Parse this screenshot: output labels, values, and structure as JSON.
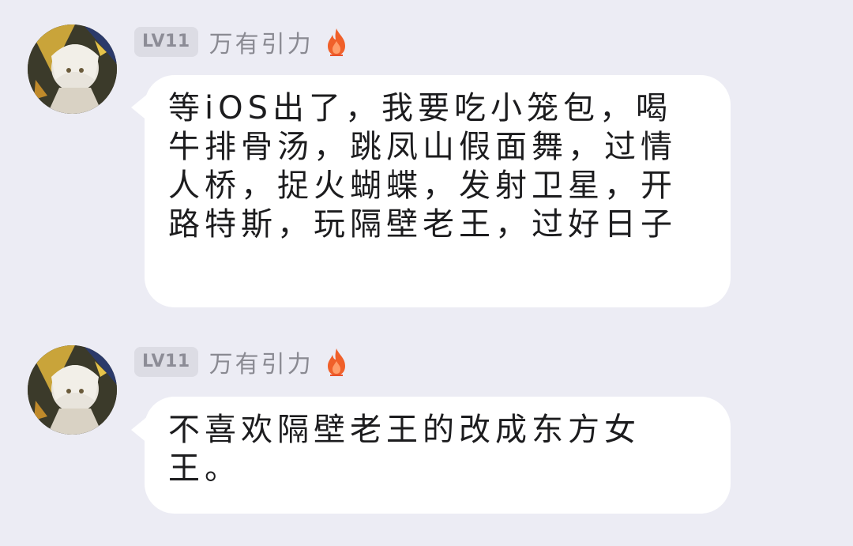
{
  "colors": {
    "background": "#ececf4",
    "bubble": "#ffffff",
    "badge_bg": "#dcdce4",
    "badge_text": "#8c8c96",
    "username": "#8a8a92",
    "flame": "#f0602a"
  },
  "messages": [
    {
      "avatar_icon": "anime-character-avatar",
      "level": "LV11",
      "username": "万有引力",
      "badge_icon": "flame-icon",
      "text": "等iOS出了，我要吃小笼包，喝牛排骨汤，跳凤山假面舞，过情人桥，捉火蝴蝶，发射卫星，开路特斯，玩隔壁老王，过好日子"
    },
    {
      "avatar_icon": "anime-character-avatar",
      "level": "LV11",
      "username": "万有引力",
      "badge_icon": "flame-icon",
      "text": "不喜欢隔壁老王的改成东方女王。"
    }
  ]
}
